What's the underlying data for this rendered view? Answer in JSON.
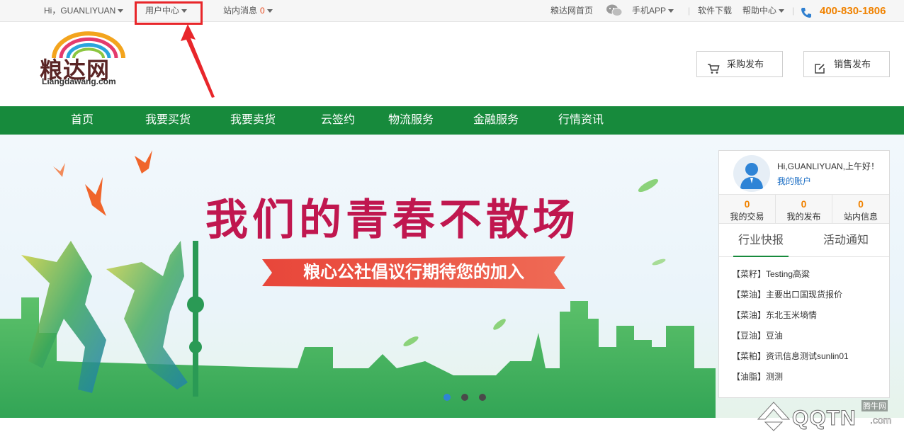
{
  "topbar": {
    "greeting": "Hi，GUANLIYUAN",
    "user_center": "用户中心",
    "site_messages": "站内消息",
    "message_count": "0",
    "home_link": "粮达网首页",
    "mobile_app": "手机APP",
    "software_download": "软件下载",
    "help_center": "帮助中心",
    "separator": "|",
    "phone": "400-830-1806"
  },
  "header": {
    "logo_text": "粮达网",
    "logo_domain": "Liangdawang.com",
    "purchase_button": "采购发布",
    "sales_button": "销售发布"
  },
  "nav": {
    "items": [
      {
        "label": "首页"
      },
      {
        "label": "我要买货"
      },
      {
        "label": "我要卖货"
      },
      {
        "label": "云签约"
      },
      {
        "label": "物流服务"
      },
      {
        "label": "金融服务"
      },
      {
        "label": "行情资讯"
      }
    ]
  },
  "banner": {
    "slogan": "我们的青春不散场",
    "subtitle": "粮心公社倡议行期待您的加入",
    "active_dot_index": 0
  },
  "panel": {
    "greeting": "Hi,GUANLIYUAN,上午好！",
    "account_link": "我的账户",
    "stats": [
      {
        "value": "0",
        "label": "我的交易"
      },
      {
        "value": "0",
        "label": "我的发布"
      },
      {
        "value": "0",
        "label": "站内信息"
      }
    ],
    "tabs": [
      {
        "label": "行业快报"
      },
      {
        "label": "活动通知"
      }
    ],
    "news": [
      {
        "text": "【菜籽】Testing高粱"
      },
      {
        "text": "【菜油】主要出口国现货报价"
      },
      {
        "text": "【菜油】东北玉米墒情"
      },
      {
        "text": "【豆油】豆油"
      },
      {
        "text": "【菜粕】资讯信息测试sunlin01"
      },
      {
        "text": "【油脂】测测"
      }
    ]
  },
  "watermark": {
    "small": "腾牛网",
    "big": "QQTN",
    "suffix": ".com"
  },
  "colors": {
    "nav_green": "#178a3c",
    "phone_orange": "#f08200",
    "highlight_red": "#e8262a",
    "slogan_magenta": "#c0174f"
  }
}
